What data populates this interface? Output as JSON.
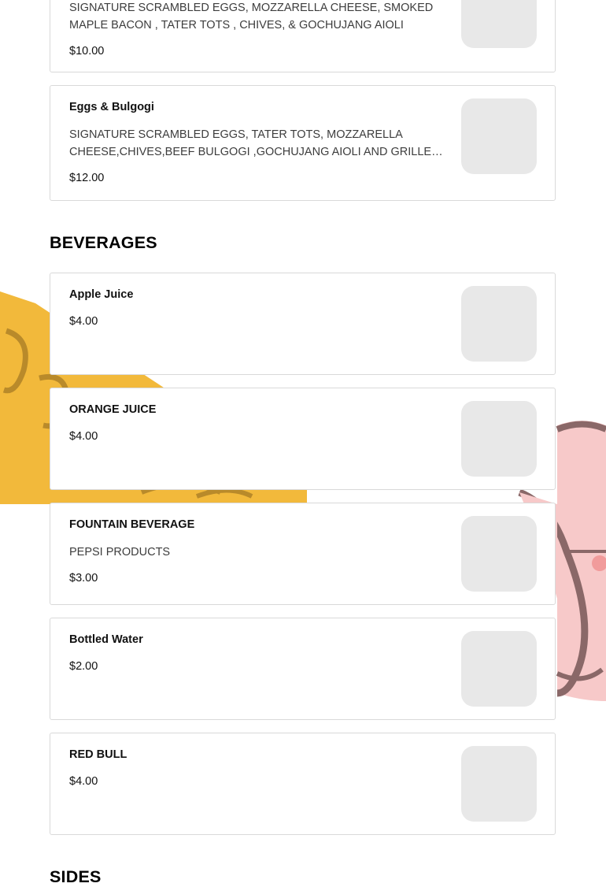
{
  "menu": {
    "top_item": {
      "desc": "SIGNATURE SCRAMBLED EGGS, MOZZARELLA CHEESE, SMOKED MAPLE BACON , TATER TOTS , CHIVES, & GOCHUJANG AIOLI",
      "price": "$10.00"
    },
    "eggs_bulgogi": {
      "name": "Eggs & Bulgogi",
      "desc": "SIGNATURE SCRAMBLED EGGS, TATER TOTS, MOZZARELLA CHEESE,CHIVES,BEEF BULGOGI ,GOCHUJANG AIOLI AND GRILLED KIMCHI",
      "price": "$12.00"
    },
    "beverages": {
      "title": "BEVERAGES",
      "items": [
        {
          "name": "Apple Juice",
          "price": "$4.00"
        },
        {
          "name": "ORANGE JUICE",
          "price": "$4.00"
        },
        {
          "name": "FOUNTAIN BEVERAGE",
          "desc": "PEPSI PRODUCTS",
          "price": "$3.00"
        },
        {
          "name": "Bottled Water",
          "price": "$2.00"
        },
        {
          "name": "RED BULL",
          "price": "$4.00"
        }
      ]
    },
    "sides": {
      "title": "SIDES"
    }
  },
  "colors": {
    "background_logo_yellow": "#f2b93b",
    "background_logo_pink": "#f7c9c9",
    "background_logo_outline": "#8a6868",
    "card_border": "#d9d9d9",
    "thumbnail_placeholder": "#e8e8e8"
  }
}
